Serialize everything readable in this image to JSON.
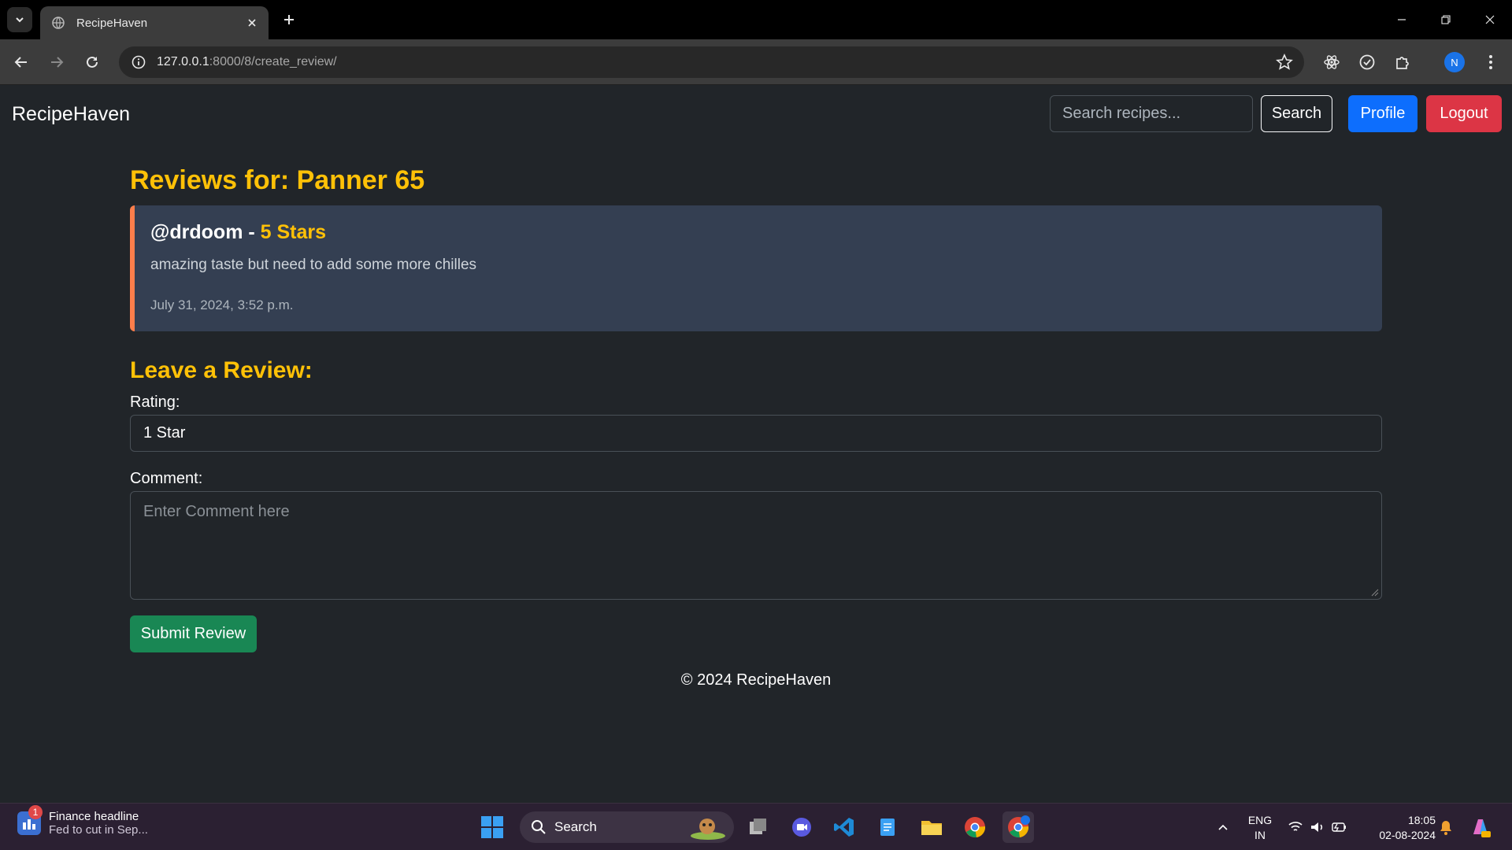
{
  "browser": {
    "tab_title": "RecipeHaven",
    "url_host": "127.0.0.1",
    "url_rest": ":8000/8/create_review/",
    "profile_initial": "N"
  },
  "navbar": {
    "brand": "RecipeHaven",
    "search_placeholder": "Search recipes...",
    "search_label": "Search",
    "profile_label": "Profile",
    "logout_label": "Logout"
  },
  "reviews": {
    "heading": "Reviews for: Panner 65",
    "items": [
      {
        "user": "@drdoom",
        "separator": " - ",
        "stars": "5 Stars",
        "comment": "amazing taste but need to add some more chilles",
        "date": "July 31, 2024, 3:52 p.m."
      }
    ]
  },
  "form": {
    "heading": "Leave a Review:",
    "rating_label": "Rating:",
    "rating_value": "1 Star",
    "comment_label": "Comment:",
    "comment_placeholder": "Enter Comment here",
    "submit_label": "Submit Review"
  },
  "footer": {
    "text": "© 2024 RecipeHaven"
  },
  "taskbar": {
    "news_badge": "1",
    "news_title": "Finance headline",
    "news_sub": "Fed to cut in Sep...",
    "search_label": "Search",
    "lang_1": "ENG",
    "lang_2": "IN",
    "time": "18:05",
    "date": "02-08-2024"
  },
  "colors": {
    "accent_yellow": "#ffc107",
    "primary": "#0d6efd",
    "danger": "#dc3545",
    "success": "#198754",
    "card_border": "#fd7e4b"
  }
}
